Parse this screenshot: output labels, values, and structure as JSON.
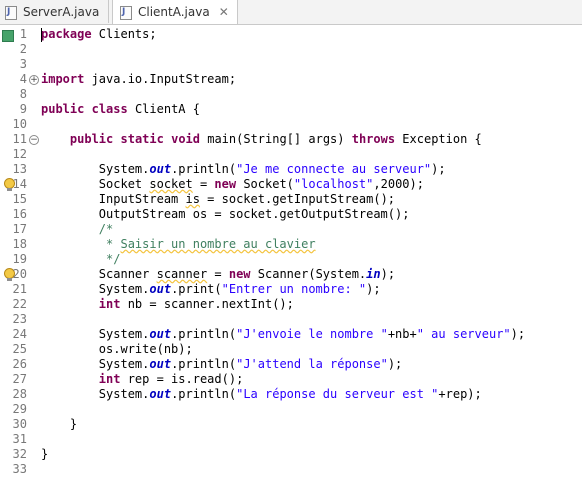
{
  "tabs": [
    {
      "label": "ServerA.java",
      "active": false
    },
    {
      "label": "ClientA.java",
      "active": true,
      "close": "✕"
    }
  ],
  "editor": {
    "lines": [
      {
        "num": "1",
        "tokens": [
          {
            "t": "package",
            "c": "kw"
          },
          {
            "t": " Clients;"
          }
        ],
        "marker": "square",
        "cursor": true
      },
      {
        "num": "2",
        "tokens": []
      },
      {
        "num": "3",
        "tokens": []
      },
      {
        "num": "4",
        "tokens": [
          {
            "t": "import",
            "c": "kw"
          },
          {
            "t": " java.io.InputStream;"
          }
        ],
        "fold": "+"
      },
      {
        "num": "8",
        "tokens": []
      },
      {
        "num": "9",
        "tokens": [
          {
            "t": "public",
            "c": "kw"
          },
          {
            "t": " "
          },
          {
            "t": "class",
            "c": "kw"
          },
          {
            "t": " ClientA {"
          }
        ]
      },
      {
        "num": "10",
        "tokens": []
      },
      {
        "num": "11",
        "tokens": [
          {
            "t": "    "
          },
          {
            "t": "public",
            "c": "kw"
          },
          {
            "t": " "
          },
          {
            "t": "static",
            "c": "kw"
          },
          {
            "t": " "
          },
          {
            "t": "void",
            "c": "kw"
          },
          {
            "t": " main(String[] args) "
          },
          {
            "t": "throws",
            "c": "kw"
          },
          {
            "t": " Exception {"
          }
        ],
        "fold": "−"
      },
      {
        "num": "12",
        "tokens": []
      },
      {
        "num": "13",
        "tokens": [
          {
            "t": "        System."
          },
          {
            "t": "out",
            "c": "fld"
          },
          {
            "t": ".println("
          },
          {
            "t": "\"Je me connecte au serveur\"",
            "c": "str"
          },
          {
            "t": ");"
          }
        ]
      },
      {
        "num": "14",
        "tokens": [
          {
            "t": "        Socket "
          },
          {
            "t": "socket",
            "c": "warn"
          },
          {
            "t": " = "
          },
          {
            "t": "new",
            "c": "kw"
          },
          {
            "t": " Socket("
          },
          {
            "t": "\"localhost\"",
            "c": "str"
          },
          {
            "t": ",2000);"
          }
        ],
        "marker": "bulb"
      },
      {
        "num": "15",
        "tokens": [
          {
            "t": "        InputStream "
          },
          {
            "t": "is",
            "c": "warn"
          },
          {
            "t": " = socket.getInputStream();"
          }
        ]
      },
      {
        "num": "16",
        "tokens": [
          {
            "t": "        OutputStream os = socket.getOutputStream();"
          }
        ]
      },
      {
        "num": "17",
        "tokens": [
          {
            "t": "        /*",
            "c": "cmt"
          }
        ]
      },
      {
        "num": "18",
        "tokens": [
          {
            "t": "         * ",
            "c": "cmt"
          },
          {
            "t": "Saisir un nombre au clavier",
            "c": "cmt warn"
          }
        ]
      },
      {
        "num": "19",
        "tokens": [
          {
            "t": "         */",
            "c": "cmt"
          }
        ]
      },
      {
        "num": "20",
        "tokens": [
          {
            "t": "        Scanner "
          },
          {
            "t": "scanner",
            "c": "warn"
          },
          {
            "t": " = "
          },
          {
            "t": "new",
            "c": "kw"
          },
          {
            "t": " Scanner(System."
          },
          {
            "t": "in",
            "c": "fld"
          },
          {
            "t": ");"
          }
        ],
        "marker": "bulb"
      },
      {
        "num": "21",
        "tokens": [
          {
            "t": "        System."
          },
          {
            "t": "out",
            "c": "fld"
          },
          {
            "t": ".print("
          },
          {
            "t": "\"Entrer un nombre: \"",
            "c": "str"
          },
          {
            "t": ");"
          }
        ]
      },
      {
        "num": "22",
        "tokens": [
          {
            "t": "        "
          },
          {
            "t": "int",
            "c": "kw"
          },
          {
            "t": " nb = scanner.nextInt();"
          }
        ]
      },
      {
        "num": "23",
        "tokens": []
      },
      {
        "num": "24",
        "tokens": [
          {
            "t": "        System."
          },
          {
            "t": "out",
            "c": "fld"
          },
          {
            "t": ".println("
          },
          {
            "t": "\"J'envoie le nombre \"",
            "c": "str"
          },
          {
            "t": "+nb+"
          },
          {
            "t": "\" au serveur\"",
            "c": "str"
          },
          {
            "t": ");"
          }
        ]
      },
      {
        "num": "25",
        "tokens": [
          {
            "t": "        os.write(nb);"
          }
        ]
      },
      {
        "num": "26",
        "tokens": [
          {
            "t": "        System."
          },
          {
            "t": "out",
            "c": "fld"
          },
          {
            "t": ".println("
          },
          {
            "t": "\"J'attend la réponse\"",
            "c": "str"
          },
          {
            "t": ");"
          }
        ]
      },
      {
        "num": "27",
        "tokens": [
          {
            "t": "        "
          },
          {
            "t": "int",
            "c": "kw"
          },
          {
            "t": " rep = is.read();"
          }
        ]
      },
      {
        "num": "28",
        "tokens": [
          {
            "t": "        System."
          },
          {
            "t": "out",
            "c": "fld"
          },
          {
            "t": ".println("
          },
          {
            "t": "\"La réponse du serveur est \"",
            "c": "str"
          },
          {
            "t": "+rep);"
          }
        ]
      },
      {
        "num": "29",
        "tokens": []
      },
      {
        "num": "30",
        "tokens": [
          {
            "t": "    }"
          }
        ]
      },
      {
        "num": "31",
        "tokens": []
      },
      {
        "num": "32",
        "tokens": [
          {
            "t": "}"
          }
        ]
      },
      {
        "num": "33",
        "tokens": []
      }
    ]
  }
}
